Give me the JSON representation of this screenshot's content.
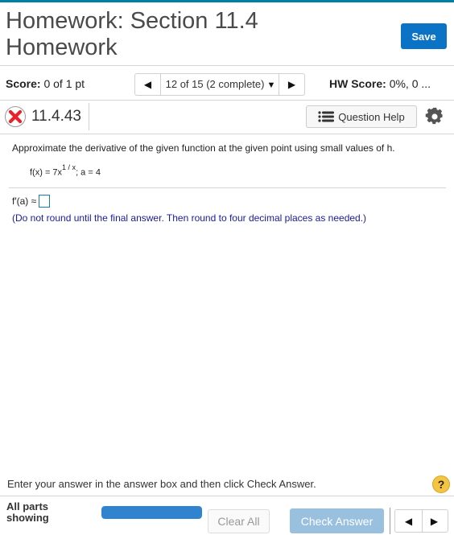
{
  "header": {
    "title": "Homework: Section 11.4 Homework",
    "save_label": "Save",
    "accent_color": "#007fa3",
    "save_color": "#0b73c6"
  },
  "score_bar": {
    "score_label": "Score:",
    "score_value": "0 of 1 pt",
    "question_selector": "12 of 15 (2 complete)",
    "hw_score_label": "HW Score:",
    "hw_score_value": "0%, 0 ..."
  },
  "question": {
    "status_icon": "incorrect-x-icon",
    "number": "11.4.43",
    "help_label": "Question Help",
    "settings_icon": "gear-icon"
  },
  "content": {
    "prompt": "Approximate the derivative of the given function at the given point using small values of h.",
    "function_lhs": "f(x) = 7x",
    "function_exponent": "1 / x",
    "function_point": "; a = 4",
    "answer_label": "f′(a) ≈",
    "answer_value": "",
    "hint": "(Do not round until the final answer. Then round to four decimal places as needed.)"
  },
  "footer": {
    "message": "Enter your answer in the answer box and then click Check Answer.",
    "help_icon": "question-mark-icon",
    "parts_label": "All parts showing",
    "progress_percent": 100,
    "clear_label": "Clear All",
    "check_label": "Check Answer"
  }
}
